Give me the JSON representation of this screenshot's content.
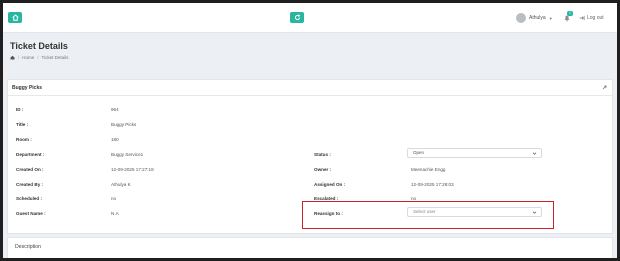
{
  "topbar": {
    "user_name": "Athulya",
    "notification_count": "1",
    "logout_label": "Log out"
  },
  "header": {
    "title": "Ticket Details",
    "breadcrumb": [
      "Home",
      "Ticket Details"
    ]
  },
  "panel": {
    "title": "Buggy Picks"
  },
  "details_left": [
    {
      "label": "ID :",
      "value": "964"
    },
    {
      "label": "Title :",
      "value": "Buggy Picks"
    },
    {
      "label": "Room :",
      "value": "180"
    },
    {
      "label": "Department :",
      "value": "Buggy Service1"
    },
    {
      "label": "Created On :",
      "value": "12-09-2025 17:27:18"
    },
    {
      "label": "Created By :",
      "value": "Athulya K"
    },
    {
      "label": "Scheduled :",
      "value": "no"
    },
    {
      "label": "Guest Name :",
      "value": "N.A"
    }
  ],
  "details_right": {
    "status_label": "Status :",
    "status_value": "Open",
    "owner_label": "Owner :",
    "owner_value": "Meenachie Engg",
    "assigned_label": "Assigned On :",
    "assigned_value": "12-09-2025 17:28:03",
    "escalated_label": "Escalated :",
    "escalated_value": "no",
    "reassign_label": "Reassign to :",
    "reassign_placeholder": "Select user"
  },
  "description": {
    "title": "Description"
  },
  "colors": {
    "accent": "#29b6a0",
    "highlight": "#cc1f2a"
  }
}
